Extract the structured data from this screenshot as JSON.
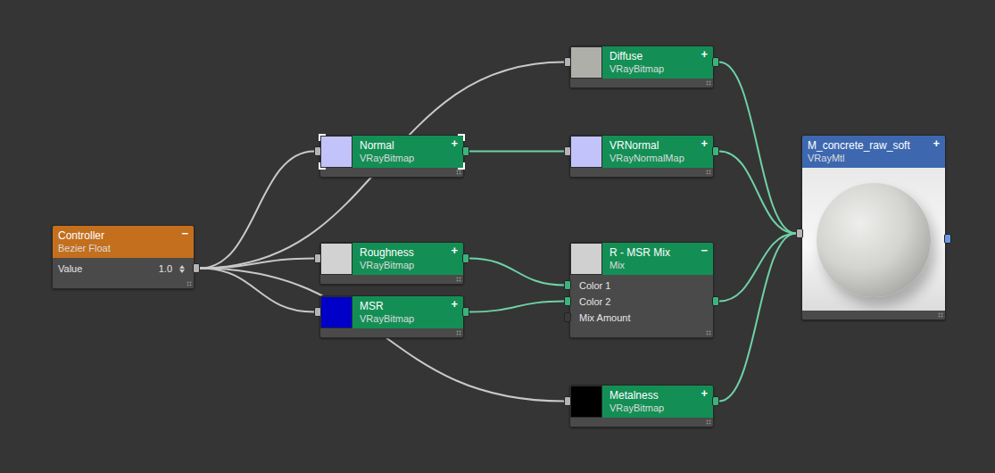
{
  "nodes": [
    {
      "title": "Controller",
      "type": "Bezier Float",
      "kind": "controller",
      "toggle": "−",
      "selected": false,
      "params": [
        {
          "label": "Value",
          "value": "1.0"
        }
      ],
      "slots": []
    },
    {
      "title": "Normal",
      "type": "VRayBitmap",
      "kind": "map",
      "toggle": "+",
      "selected": true,
      "color": "#c3c3fb",
      "params": [],
      "slots": []
    },
    {
      "title": "Roughness",
      "type": "VRayBitmap",
      "kind": "map",
      "toggle": "+",
      "selected": false,
      "color": "#d2d2d2",
      "params": [],
      "slots": []
    },
    {
      "title": "MSR",
      "type": "VRayBitmap",
      "kind": "map",
      "toggle": "+",
      "selected": false,
      "color": "#0000c8",
      "params": [],
      "slots": []
    },
    {
      "title": "Diffuse",
      "type": "VRayBitmap",
      "kind": "map",
      "toggle": "+",
      "selected": false,
      "color": "#aeafa8",
      "params": [],
      "slots": []
    },
    {
      "title": "VRNormal",
      "type": "VRayNormalMap",
      "kind": "map",
      "toggle": "+",
      "selected": false,
      "color": "#c3c3fb",
      "params": [],
      "slots": []
    },
    {
      "title": "R - MSR Mix",
      "type": "Mix",
      "kind": "map",
      "toggle": "−",
      "selected": false,
      "color": "#d0d0d0",
      "params": [],
      "slots": [
        {
          "label": "Color 1",
          "connected": true
        },
        {
          "label": "Color 2",
          "connected": true
        },
        {
          "label": "Mix Amount",
          "connected": false
        }
      ]
    },
    {
      "title": "Metalness",
      "type": "VRayBitmap",
      "kind": "map",
      "toggle": "+",
      "selected": false,
      "color": "#000000",
      "params": [],
      "slots": []
    },
    {
      "title": "M_concrete_raw_soft",
      "type": "VRayMtl",
      "kind": "material",
      "toggle": "+",
      "selected": false,
      "params": [],
      "slots": []
    }
  ],
  "edges": [
    {
      "from": 0,
      "to": 1,
      "slot": null
    },
    {
      "from": 0,
      "to": 2,
      "slot": null
    },
    {
      "from": 0,
      "to": 3,
      "slot": null
    },
    {
      "from": 0,
      "to": 4,
      "slot": null
    },
    {
      "from": 0,
      "to": 7,
      "slot": null
    },
    {
      "from": 1,
      "to": 5,
      "slot": null
    },
    {
      "from": 2,
      "to": 6,
      "slot": 0
    },
    {
      "from": 3,
      "to": 6,
      "slot": 1
    },
    {
      "from": 4,
      "to": 8,
      "slot": null
    },
    {
      "from": 5,
      "to": 8,
      "slot": null
    },
    {
      "from": 6,
      "to": 8,
      "slot": null
    },
    {
      "from": 7,
      "to": 8,
      "slot": null
    }
  ]
}
